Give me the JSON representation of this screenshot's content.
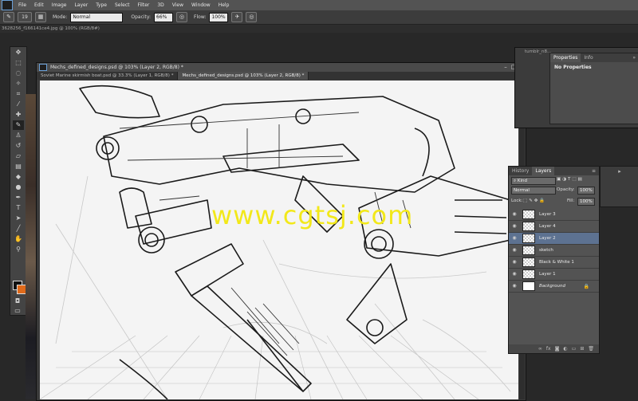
{
  "menu": [
    "File",
    "Edit",
    "Image",
    "Layer",
    "Type",
    "Select",
    "Filter",
    "3D",
    "View",
    "Window",
    "Help"
  ],
  "options_bar": {
    "brush_size": "19",
    "mode_label": "Mode:",
    "mode_value": "Normal",
    "opacity_label": "Opacity:",
    "opacity_value": "66%",
    "flow_label": "Flow:",
    "flow_value": "100%"
  },
  "background_tab": "3628256_f166141ce4.jpg @ 100% (RGB/8#)",
  "doc2_title": "tumblr_n8...",
  "document": {
    "title": "Mechs_defined_designs.psd @ 103% (Layer 2, RGB/8) *",
    "tabs": [
      "Soviet Marine skirmish boat.psd @ 33.3% (Layer 1, RGB/8) *",
      "Mechs_defined_designs.psd @ 103% (Layer 2, RGB/8) *"
    ]
  },
  "watermark": "www.cgtsj.com",
  "properties_panel": {
    "tabs": [
      "Properties",
      "Info"
    ],
    "content": "No Properties"
  },
  "layers_panel": {
    "tabs": [
      "History",
      "Layers"
    ],
    "filter": "Kind",
    "blend_mode": "Normal",
    "opacity_label": "Opacity:",
    "opacity_value": "100%",
    "lock_label": "Lock:",
    "fill_label": "Fill:",
    "fill_value": "100%",
    "layers": [
      {
        "name": "Layer 3"
      },
      {
        "name": "Layer 4"
      },
      {
        "name": "Layer 2"
      },
      {
        "name": "sketch"
      },
      {
        "name": "Black & White 1"
      },
      {
        "name": "Layer 1"
      },
      {
        "name": "Background"
      }
    ]
  },
  "colors": {
    "foreground": "#111111",
    "background": "#e06a1a",
    "watermark": "#f2e81a",
    "selected_layer": "#5d7291"
  }
}
